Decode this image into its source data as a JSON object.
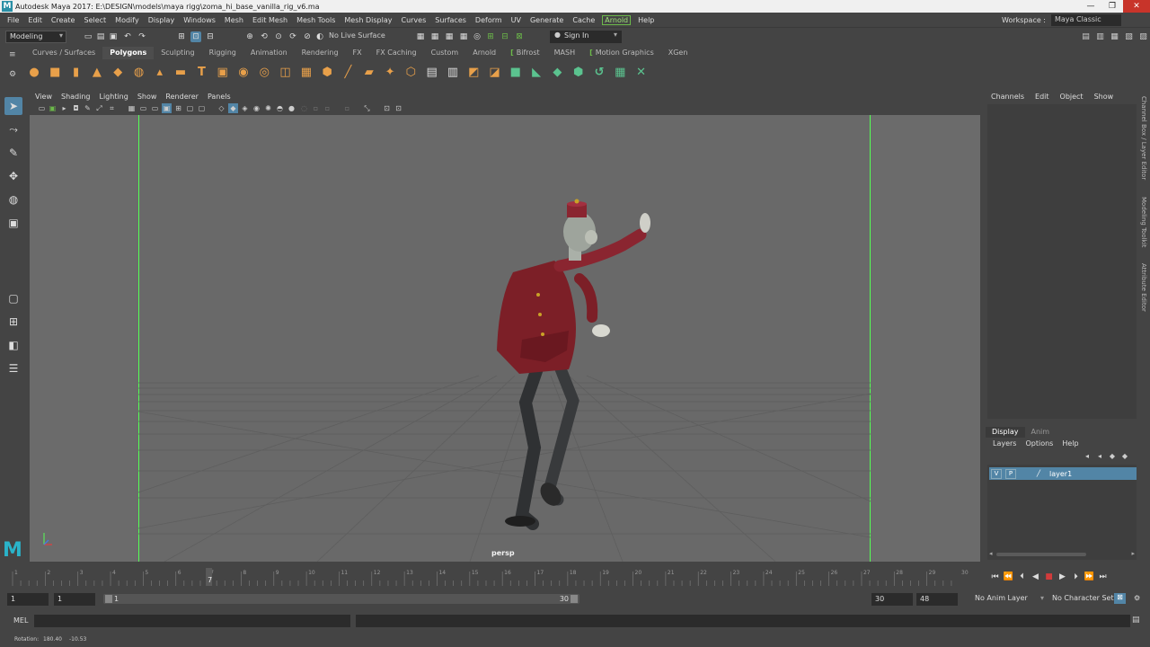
{
  "window": {
    "title": "Autodesk Maya 2017: E:\\DESIGN\\models\\maya rigg\\zoma_hi_base_vanilla_rig_v6.ma",
    "logo": "M"
  },
  "menubar": {
    "items": [
      "File",
      "Edit",
      "Create",
      "Select",
      "Modify",
      "Display",
      "Windows",
      "Mesh",
      "Edit Mesh",
      "Mesh Tools",
      "Mesh Display",
      "Curves",
      "Surfaces",
      "Deform",
      "UV",
      "Generate",
      "Cache",
      "Arnold",
      "Help"
    ],
    "workspace_label": "Workspace :",
    "workspace_value": "Maya Classic"
  },
  "statusline": {
    "mode": "Modeling",
    "live_surface": "No Live Surface",
    "sign_in": "Sign In"
  },
  "shelf": {
    "tabs": [
      "Curves / Surfaces",
      "Polygons",
      "Sculpting",
      "Rigging",
      "Animation",
      "Rendering",
      "FX",
      "FX Caching",
      "Custom",
      "Arnold",
      "Bifrost",
      "MASH",
      "Motion Graphics",
      "XGen"
    ],
    "active_tab": "Polygons"
  },
  "viewport": {
    "menus": [
      "View",
      "Shading",
      "Lighting",
      "Show",
      "Renderer",
      "Panels"
    ],
    "camera": "persp",
    "gate_color": "#55ff55",
    "background": "#6b6b6b"
  },
  "channel_box": {
    "menus": [
      "Channels",
      "Edit",
      "Object",
      "Show"
    ]
  },
  "layer_editor": {
    "tabs": [
      "Display",
      "Anim"
    ],
    "active_tab": "Display",
    "menus": [
      "Layers",
      "Options",
      "Help"
    ],
    "layer": {
      "v": "V",
      "p": "P",
      "name": "layer1"
    }
  },
  "side_tabs": [
    "Channel Box / Layer Editor",
    "Modeling Toolkit",
    "Attribute Editor"
  ],
  "timeline": {
    "ticks": [
      "1",
      "2",
      "3",
      "4",
      "5",
      "6",
      "7",
      "8",
      "9",
      "10",
      "11",
      "12",
      "13",
      "14",
      "15",
      "16",
      "17",
      "18",
      "19",
      "20",
      "21",
      "22",
      "23",
      "24",
      "25",
      "26",
      "27",
      "28",
      "29",
      "30"
    ],
    "current_frame": "7",
    "end_readout": "1"
  },
  "range": {
    "start": "1",
    "playback_start": "1",
    "range_start": "1",
    "range_end": "30",
    "playback_end": "30",
    "end": "48",
    "anim_layer": "No Anim Layer",
    "character_set": "No Character Set"
  },
  "command": {
    "label": "MEL"
  },
  "helpline": {
    "label": "Rotation:",
    "x": "180.40",
    "y": "-10.53"
  }
}
